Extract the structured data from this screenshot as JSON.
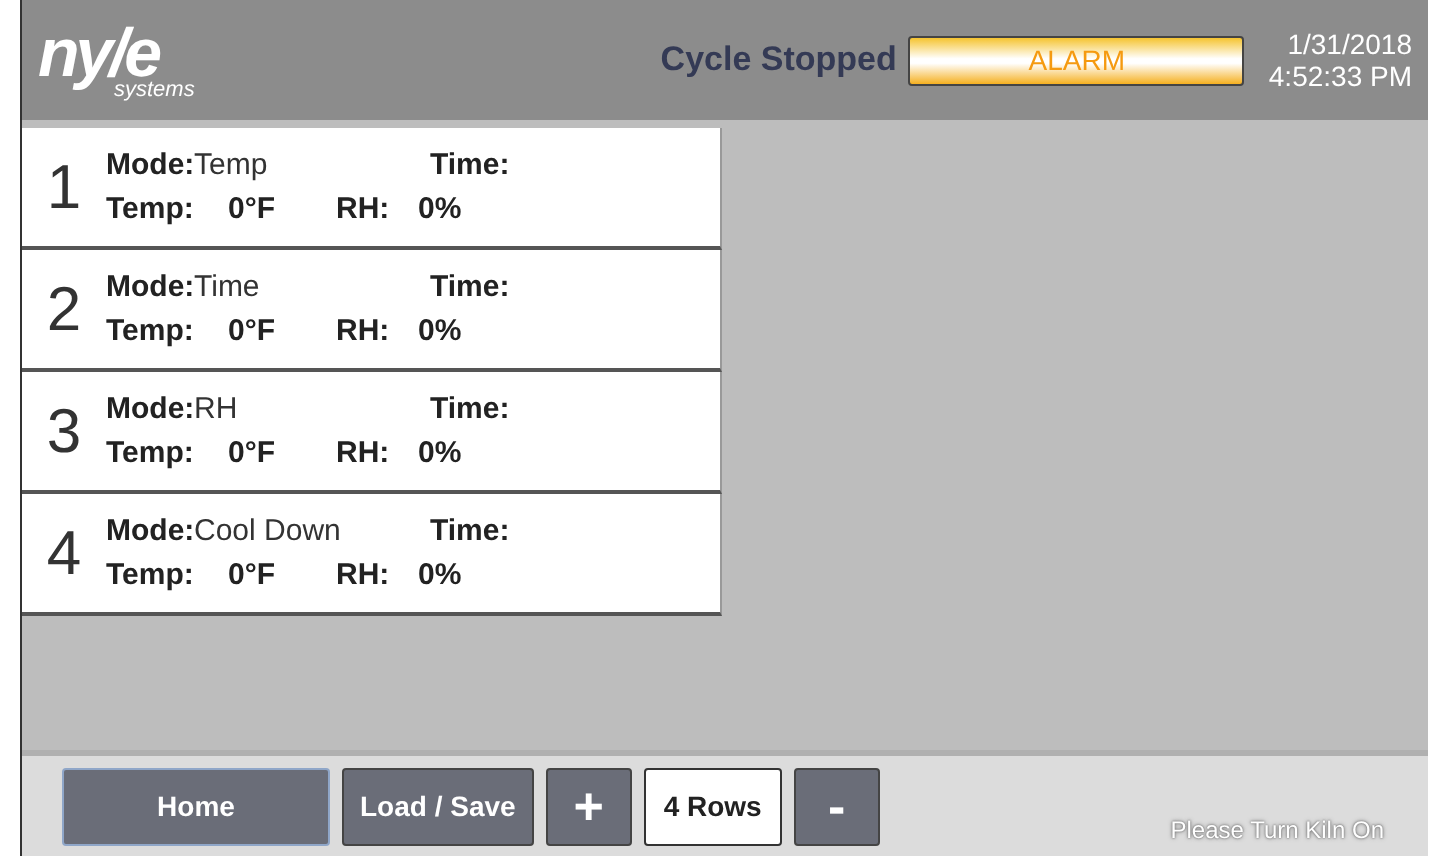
{
  "header": {
    "logo": {
      "wordmark": "ny/e",
      "tagline": "systems"
    },
    "status": "Cycle Stopped",
    "alarm": "ALARM",
    "date": "1/31/2018",
    "time": "4:52:33 PM"
  },
  "steps": [
    {
      "number": "1",
      "mode_label": "Mode:",
      "mode": "Temp",
      "time_label": "Time:",
      "temp_label": "Temp:",
      "temp": "0°F",
      "rh_label": "RH:",
      "rh": "0%"
    },
    {
      "number": "2",
      "mode_label": "Mode:",
      "mode": "Time",
      "time_label": "Time:",
      "temp_label": "Temp:",
      "temp": "0°F",
      "rh_label": "RH:",
      "rh": "0%"
    },
    {
      "number": "3",
      "mode_label": "Mode:",
      "mode": "RH",
      "time_label": "Time:",
      "temp_label": "Temp:",
      "temp": "0°F",
      "rh_label": "RH:",
      "rh": "0%"
    },
    {
      "number": "4",
      "mode_label": "Mode:",
      "mode": "Cool Down",
      "time_label": "Time:",
      "temp_label": "Temp:",
      "temp": "0°F",
      "rh_label": "RH:",
      "rh": "0%"
    }
  ],
  "footer": {
    "buttons": [
      {
        "kind": "nav",
        "label": "Home",
        "selected": true
      },
      {
        "kind": "nav",
        "label": "Load / Save",
        "selected": false
      },
      {
        "kind": "icon",
        "label": "+"
      },
      {
        "kind": "count",
        "label": "4 Rows"
      },
      {
        "kind": "icon",
        "label": "-"
      }
    ],
    "message": "Please Turn Kiln On"
  }
}
